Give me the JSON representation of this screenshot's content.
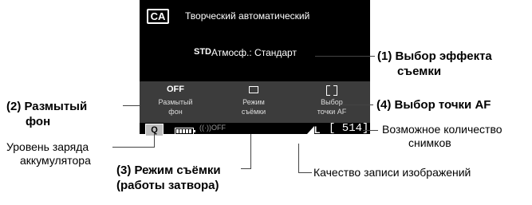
{
  "screen": {
    "mode_badge": "CA",
    "mode_title": "Творческий автоматический",
    "std_icon": "STD",
    "ambience": "Атмосф.: Стандарт",
    "settings": [
      {
        "value": "OFF",
        "label": "Размытый\nфон"
      },
      {
        "value": "",
        "label": "Режим\nсъёмки"
      },
      {
        "value": "",
        "label": "Выбор\nточки AF"
      }
    ],
    "q_button": "Q",
    "wifi": "((·))OFF",
    "quality": "L",
    "shots": "[ 514]"
  },
  "callouts": {
    "effect": "(1) Выбор эффекта\nсъемки",
    "blur": "(2) Размытый\nфон",
    "drive": "(3) Режим съёмки\n(работы затвора)",
    "af": "(4) Выбор точки AF"
  },
  "notes": {
    "battery": "Уровень заряда\nаккумулятора",
    "shots": "Возможное количество\nснимков",
    "quality": "Качество записи изображений"
  }
}
